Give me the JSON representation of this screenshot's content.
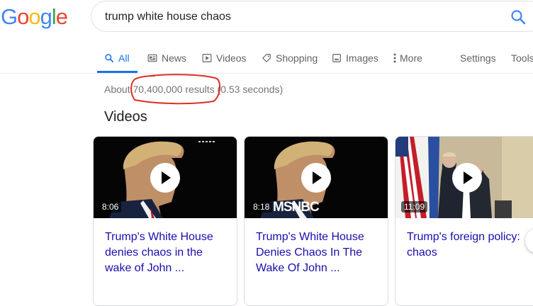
{
  "logo": {
    "letters": [
      "G",
      "o",
      "o",
      "g",
      "l",
      "e"
    ],
    "colors": [
      "#4285F4",
      "#EA4335",
      "#FBBC05",
      "#4285F4",
      "#34A853",
      "#EA4335"
    ]
  },
  "search": {
    "query": "trump white house chaos",
    "icon": "search-icon"
  },
  "tabs": [
    {
      "label": "All",
      "icon": "search-icon",
      "active": true
    },
    {
      "label": "News",
      "icon": "news-icon"
    },
    {
      "label": "Videos",
      "icon": "play-icon"
    },
    {
      "label": "Shopping",
      "icon": "tag-icon"
    },
    {
      "label": "Images",
      "icon": "image-icon"
    },
    {
      "label": "More",
      "icon": "more-vert-icon"
    }
  ],
  "tools": {
    "settings": "Settings",
    "tools": "Tools"
  },
  "result_stats": "About 70,400,000 results (0.53 seconds)",
  "videos_heading": "Videos",
  "videos": [
    {
      "duration": "8:06",
      "title": "Trump's White House denies chaos in the wake of John ..."
    },
    {
      "duration": "8:18",
      "channel_logo": "MSNBC",
      "title": "Trump's White House Denies Chaos In The Wake Of John ..."
    },
    {
      "duration": "11:09",
      "title": "Trump's foreign policy: chaos"
    }
  ],
  "colors": {
    "accent": "#1a73e8",
    "link": "#1a0dab",
    "annotation": "#d93025"
  }
}
